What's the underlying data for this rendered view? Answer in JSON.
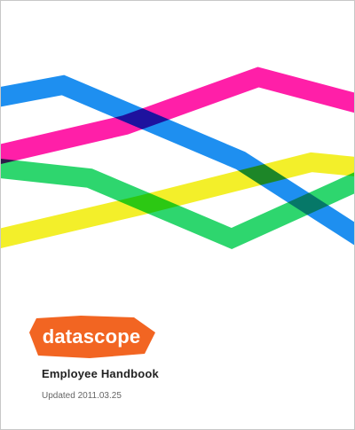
{
  "brand": {
    "name": "datascope",
    "accent": "#f26522"
  },
  "document": {
    "title": "Employee Handbook",
    "updated": "Updated 2011.03.25"
  },
  "ribbons": {
    "blue": "#1e8ff0",
    "magenta": "#ff1fa8",
    "yellow": "#f3ef2a",
    "green": "#2ed66e"
  }
}
